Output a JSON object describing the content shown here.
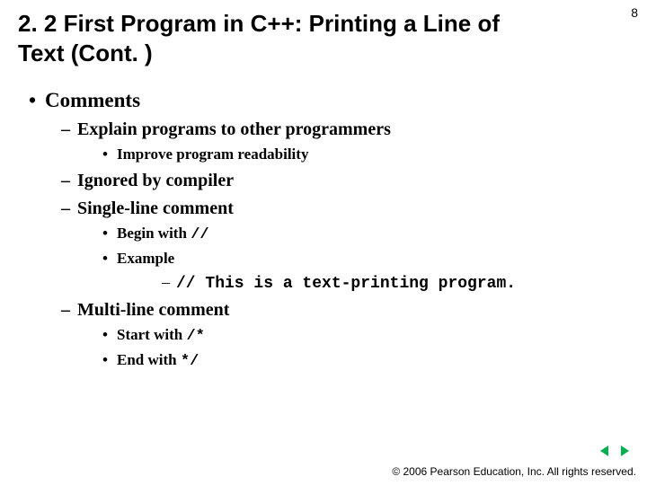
{
  "pageNumber": "8",
  "title": "2. 2 First Program in C++: Printing a Line of Text (Cont. )",
  "bullets": {
    "comments": "Comments",
    "explain": "Explain programs to other programmers",
    "improve": "Improve program readability",
    "ignored": "Ignored by compiler",
    "single": "Single-line comment",
    "beginWith": "Begin with ",
    "beginCode": "//",
    "exampleLabel": "Example",
    "exampleCode": "// This is a text-printing program.",
    "multi": "Multi-line comment",
    "startWith": "Start with ",
    "startCode": "/*",
    "endWith": "End with ",
    "endCode": "*/"
  },
  "footer": "© 2006 Pearson Education, Inc.  All rights reserved."
}
